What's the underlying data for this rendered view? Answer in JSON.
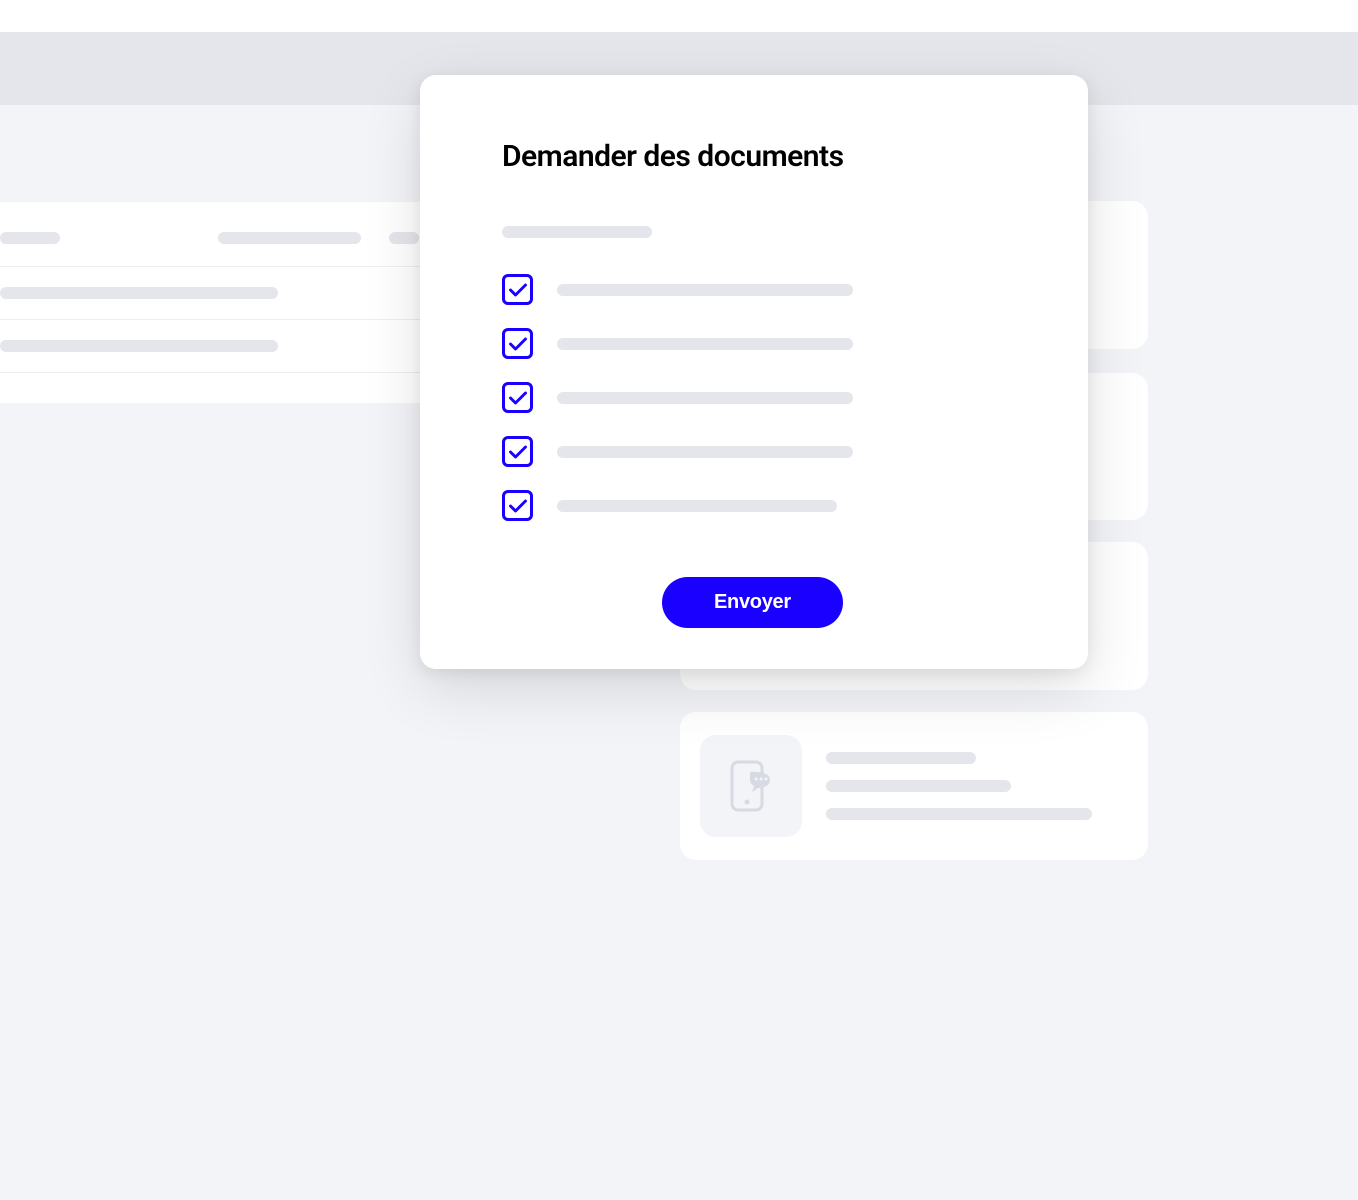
{
  "modal": {
    "title": "Demander des documents",
    "submit_label": "Envoyer",
    "items": [
      {
        "checked": true
      },
      {
        "checked": true
      },
      {
        "checked": true
      },
      {
        "checked": true
      },
      {
        "checked": true
      }
    ]
  },
  "colors": {
    "primary": "#1a00ff",
    "skeleton": "#e5e6eb",
    "bg_light": "#f3f4f8"
  }
}
